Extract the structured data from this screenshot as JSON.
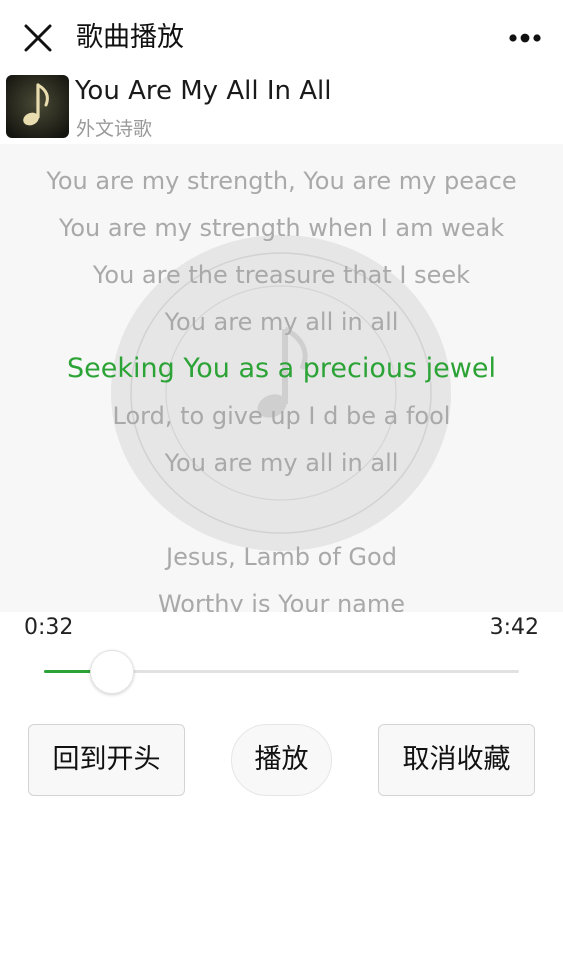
{
  "header": {
    "title": "歌曲播放",
    "close_icon": "close-icon",
    "more_icon": "more-dots-icon"
  },
  "song": {
    "title": "You Are My All In All",
    "subtitle": "外文诗歌",
    "album_icon": "music-note-icon"
  },
  "lyrics": {
    "lines": [
      "You are my strength, You are my peace",
      "You are my strength when I am weak",
      "You are the treasure that I seek",
      "You are my all in all",
      "Seeking You as a precious jewel",
      "Lord, to give up I d be a fool",
      "You are my all in all",
      "",
      "Jesus, Lamb of God",
      "Worthy is Your name"
    ],
    "current_index": 4,
    "highlight_color": "#2ca336"
  },
  "player": {
    "current_time": "0:32",
    "total_time": "3:42",
    "progress_fraction": 0.144,
    "accent_color": "#2ca336"
  },
  "buttons": {
    "restart": "回到开头",
    "play": "播放",
    "unfavorite": "取消收藏"
  }
}
